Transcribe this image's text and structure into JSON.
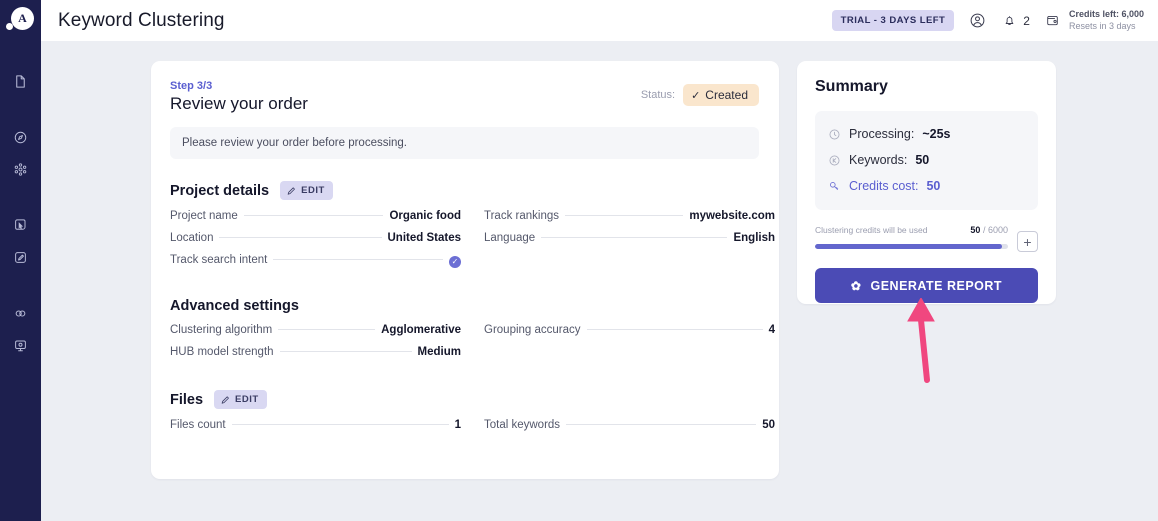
{
  "app": {
    "logo_letter": "A",
    "page_title": "Keyword Clustering"
  },
  "sidebar": {
    "items": [
      {
        "name": "document",
        "icon": "document-icon"
      },
      {
        "name": "compass",
        "icon": "compass-icon"
      },
      {
        "name": "network",
        "icon": "network-icon"
      },
      {
        "name": "cursor",
        "icon": "cursor-icon"
      },
      {
        "name": "edit-square",
        "icon": "edit-square-icon"
      },
      {
        "name": "link",
        "icon": "link-icon"
      },
      {
        "name": "monitor",
        "icon": "monitor-icon"
      }
    ]
  },
  "topbar": {
    "trial_badge": "TRIAL - 3 DAYS LEFT",
    "account_icon": "account-icon",
    "bell_icon": "bell-icon",
    "bell_count": "2",
    "wallet_icon": "wallet-icon",
    "credits_left": "Credits left: 6,000",
    "credits_reset": "Resets in 3 days"
  },
  "order": {
    "step": "Step 3/3",
    "title": "Review your order",
    "status_label": "Status:",
    "status_value": "Created",
    "status_check": "✓",
    "notice": "Please review your order before processing.",
    "sections": [
      {
        "title": "Project details",
        "edit_label": "EDIT",
        "has_edit": true,
        "fields": [
          {
            "label": "Project name",
            "value": "Organic food",
            "type": "text"
          },
          {
            "label": "Track rankings",
            "value": "mywebsite.com",
            "type": "text"
          },
          {
            "label": "Location",
            "value": "United States",
            "type": "text"
          },
          {
            "label": "Language",
            "value": "English",
            "type": "text"
          },
          {
            "label": "Track search intent",
            "value": "",
            "type": "check"
          },
          {
            "label": "",
            "value": "",
            "type": "empty"
          }
        ]
      },
      {
        "title": "Advanced settings",
        "edit_label": "",
        "has_edit": false,
        "fields": [
          {
            "label": "Clustering algorithm",
            "value": "Agglomerative",
            "type": "text"
          },
          {
            "label": "Grouping accuracy",
            "value": "4",
            "type": "text"
          },
          {
            "label": "HUB model strength",
            "value": "Medium",
            "type": "text"
          },
          {
            "label": "",
            "value": "",
            "type": "empty"
          }
        ]
      },
      {
        "title": "Files",
        "edit_label": "EDIT",
        "has_edit": true,
        "fields": [
          {
            "label": "Files count",
            "value": "1",
            "type": "text"
          },
          {
            "label": "Total keywords",
            "value": "50",
            "type": "text"
          }
        ]
      }
    ]
  },
  "summary": {
    "title": "Summary",
    "stats": [
      {
        "icon": "clock-icon",
        "label": "Processing:",
        "value": "~25s",
        "accent": false
      },
      {
        "icon": "keyword-circle-icon",
        "label": "Keywords:",
        "value": "50",
        "accent": false
      },
      {
        "icon": "key-icon",
        "label": "Credits cost:",
        "value": "50",
        "accent": true
      }
    ],
    "meter_caption": "Clustering credits will be used",
    "meter_used": "50",
    "meter_sep": "/",
    "meter_total": "6000",
    "meter_percent": 97,
    "plus_label": "+",
    "generate_label": "GENERATE REPORT",
    "generate_icon": "✿"
  },
  "annotation": {
    "arrow_color": "#f0477f",
    "points_to": "generate-report-button"
  },
  "colors": {
    "sidebar_bg": "#1d1f4e",
    "page_bg": "#eceef3",
    "accent_purple": "#5a5ed0",
    "button_purple": "#4b4bb5",
    "status_badge_bg": "#fae6cd",
    "trial_badge_bg": "#d8d6f2"
  }
}
